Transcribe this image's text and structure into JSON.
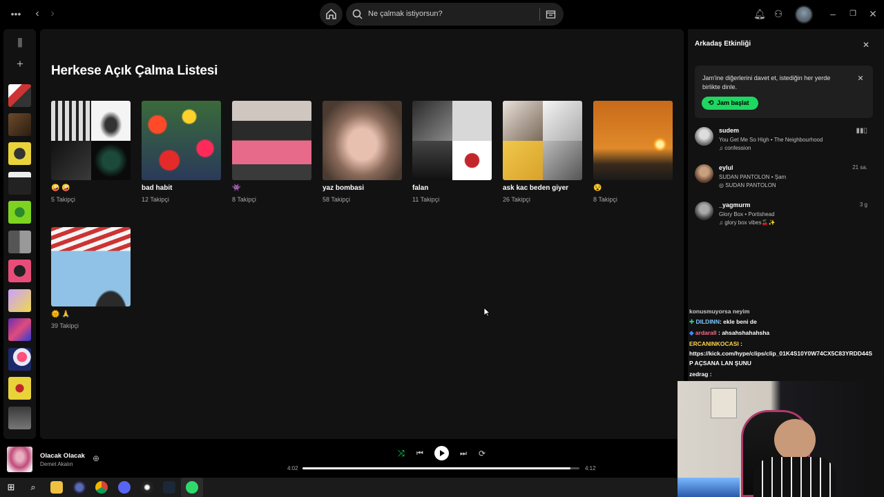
{
  "topbar": {
    "search_placeholder": "Ne çalmak istiyorsun?",
    "icons": [
      "more-icon",
      "back-icon",
      "forward-icon",
      "home-icon",
      "search-icon",
      "browse-icon",
      "bell-icon",
      "friends-icon",
      "avatar",
      "minimize-icon",
      "maximize-icon",
      "close-icon"
    ]
  },
  "main": {
    "heading": "Herkese Açık Çalma Listesi",
    "playlists": [
      {
        "title": "🤪 🤪",
        "followers": "5 Takipçi"
      },
      {
        "title": "bad habit",
        "followers": "12 Takipçi"
      },
      {
        "title": "👾",
        "followers": "8 Takipçi"
      },
      {
        "title": "yaz bombasi",
        "followers": "58 Takipçi"
      },
      {
        "title": "falan",
        "followers": "11 Takipçi"
      },
      {
        "title": "ask kac beden giyer",
        "followers": "26 Takipçi"
      },
      {
        "title": "😵",
        "followers": "8 Takipçi"
      },
      {
        "title": "🌞 🙏",
        "followers": "39 Takipçi"
      }
    ]
  },
  "friend_activity": {
    "title": "Arkadaş Etkinliği",
    "jam_text": "Jam'ine diğerlerini davet et, istediğin her yerde birlikte dinle.",
    "jam_button": "Jam başlat",
    "friends": [
      {
        "name": "sudem",
        "song": "You Get Me So High • The Neighbourhood",
        "playlist": "♫ confession",
        "time": ""
      },
      {
        "name": "eylul",
        "song": "SUDAN PANTOLON • Şam",
        "playlist": "◎ SUDAN PANTOLON",
        "time": "21 sa."
      },
      {
        "name": "_yagmurm",
        "song": "Glory Box • Portishead",
        "playlist": "♫ glory box vibes🍒✨",
        "time": "3 g"
      }
    ]
  },
  "chat": {
    "lines": [
      {
        "user": "",
        "text": "konusmuyorsa neyim"
      },
      {
        "user": "DILDINN",
        "text": ": ekle beni de"
      },
      {
        "user": "ardarall",
        "text": ": ahsahshahahsha"
      },
      {
        "user": "ERCANINKOCASI",
        "text": " :"
      },
      {
        "user": "",
        "text": "https://kick.com/hype/clips/clip_01K4S10Y0W74CX5C83YRDD44S"
      },
      {
        "user": "",
        "text": "P AÇSANA LAN ŞUNU"
      },
      {
        "user": "zedrag",
        "text": " :"
      }
    ],
    "colors": {
      "DILDINN": "#7ec8ff",
      "ardarall": "#ff6b8a",
      "ERCANINKOCASI": "#ffd24a",
      "zedrag": "#ffffff"
    }
  },
  "player": {
    "track": "Olacak Olacak",
    "artist": "Demet Akalın",
    "elapsed": "4:02",
    "duration": "4:12",
    "progress": 0.968
  },
  "colors": {
    "accent": "#1ed760",
    "bg": "#121212"
  }
}
